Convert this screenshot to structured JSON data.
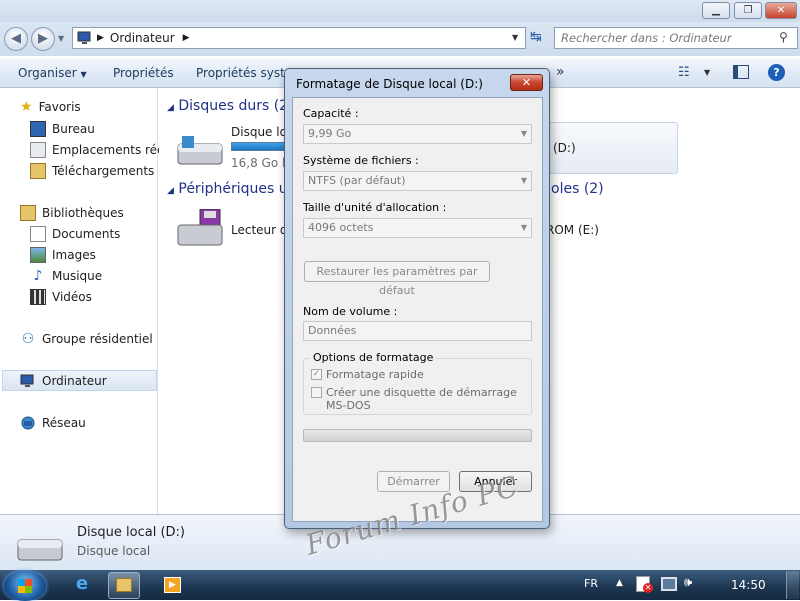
{
  "explorer": {
    "address": {
      "path": "Ordinateur"
    },
    "search": {
      "placeholder": "Rechercher dans : Ordinateur"
    },
    "toolbar": {
      "organize_label": "Organiser",
      "properties_label": "Propriétés",
      "system_properties_label": "Propriétés systèm",
      "more_label": "»"
    },
    "sidebar": {
      "favorites": "Favoris",
      "desktop": "Bureau",
      "recent": "Emplacements récer",
      "downloads": "Téléchargements",
      "libraries": "Bibliothèques",
      "documents": "Documents",
      "images": "Images",
      "music": "Musique",
      "videos": "Vidéos",
      "homegroup": "Groupe résidentiel",
      "computer": "Ordinateur",
      "network": "Réseau"
    },
    "main": {
      "hard_drives_header": "Disques durs (2)",
      "drive_c_name": "Disque loc",
      "drive_c_free": "16,8 Go libr",
      "drive_d_letter": "(D:)",
      "removable_header": "Périphériques u",
      "removable_header_tail": "oles (2)",
      "floppy_name": "Lecteur de",
      "cdrom_name": "ROM (E:)"
    },
    "details": {
      "name": "Disque local (D:)",
      "type": "Disque local"
    }
  },
  "dialog": {
    "title": "Formatage de Disque local (D:)",
    "close_label": "✕",
    "capacity_label": "Capacité :",
    "capacity_value": "9,99 Go",
    "filesystem_label": "Système de fichiers :",
    "filesystem_value": "NTFS (par défaut)",
    "alloc_label": "Taille d'unité d'allocation :",
    "alloc_value": "4096 octets",
    "restore_label": "Restaurer les paramètres par défaut",
    "volume_label": "Nom de volume :",
    "volume_value": "Données",
    "options_label": "Options de formatage",
    "quick_format_label": "Formatage rapide",
    "quick_format_checked": true,
    "msdos_label_line1": "Créer une disquette de démarrage",
    "msdos_label_line2": "MS-DOS",
    "msdos_checked": false,
    "progress": 0,
    "start_label": "Démarrer",
    "cancel_label": "Annuler"
  },
  "taskbar": {
    "language": "FR",
    "clock": "14:50"
  },
  "watermark": "Forum Info PC",
  "colors": {
    "group_header": "#1e3287",
    "close_red": "#c9442e",
    "taskbar": "#1c3550"
  }
}
